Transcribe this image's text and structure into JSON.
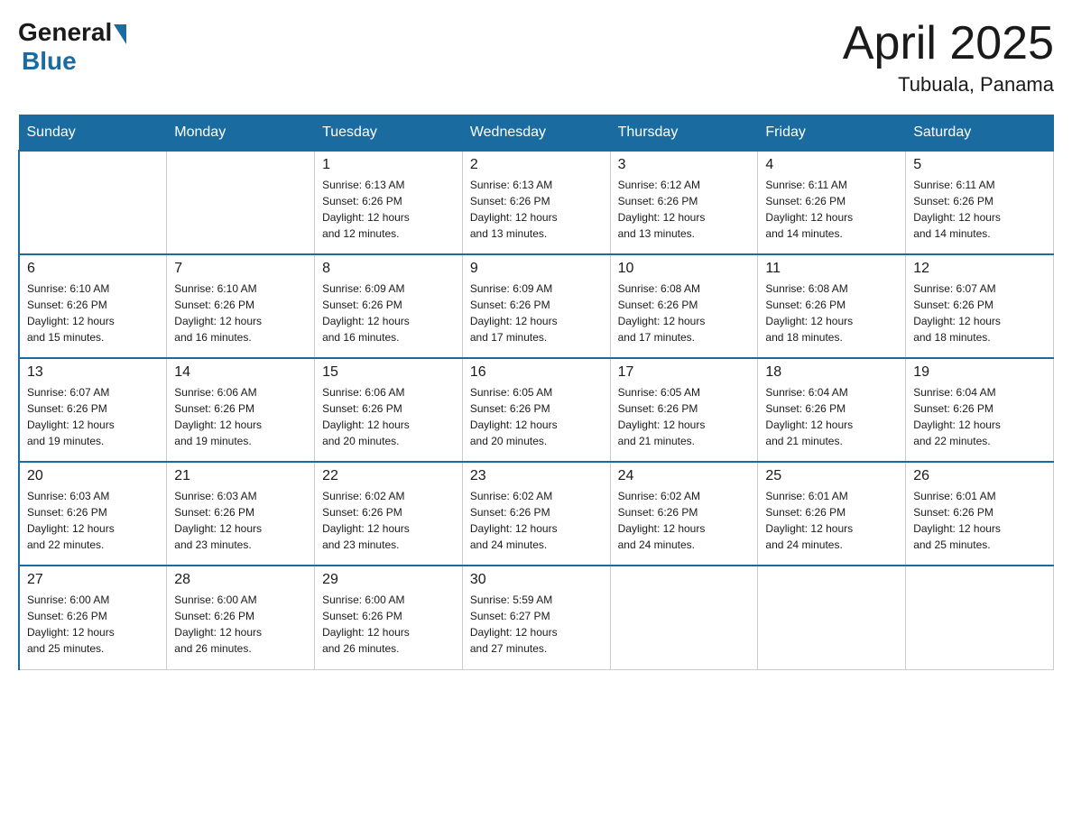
{
  "logo": {
    "general": "General",
    "blue": "Blue"
  },
  "title": "April 2025",
  "location": "Tubuala, Panama",
  "days_of_week": [
    "Sunday",
    "Monday",
    "Tuesday",
    "Wednesday",
    "Thursday",
    "Friday",
    "Saturday"
  ],
  "weeks": [
    [
      {
        "day": "",
        "info": ""
      },
      {
        "day": "",
        "info": ""
      },
      {
        "day": "1",
        "info": "Sunrise: 6:13 AM\nSunset: 6:26 PM\nDaylight: 12 hours\nand 12 minutes."
      },
      {
        "day": "2",
        "info": "Sunrise: 6:13 AM\nSunset: 6:26 PM\nDaylight: 12 hours\nand 13 minutes."
      },
      {
        "day": "3",
        "info": "Sunrise: 6:12 AM\nSunset: 6:26 PM\nDaylight: 12 hours\nand 13 minutes."
      },
      {
        "day": "4",
        "info": "Sunrise: 6:11 AM\nSunset: 6:26 PM\nDaylight: 12 hours\nand 14 minutes."
      },
      {
        "day": "5",
        "info": "Sunrise: 6:11 AM\nSunset: 6:26 PM\nDaylight: 12 hours\nand 14 minutes."
      }
    ],
    [
      {
        "day": "6",
        "info": "Sunrise: 6:10 AM\nSunset: 6:26 PM\nDaylight: 12 hours\nand 15 minutes."
      },
      {
        "day": "7",
        "info": "Sunrise: 6:10 AM\nSunset: 6:26 PM\nDaylight: 12 hours\nand 16 minutes."
      },
      {
        "day": "8",
        "info": "Sunrise: 6:09 AM\nSunset: 6:26 PM\nDaylight: 12 hours\nand 16 minutes."
      },
      {
        "day": "9",
        "info": "Sunrise: 6:09 AM\nSunset: 6:26 PM\nDaylight: 12 hours\nand 17 minutes."
      },
      {
        "day": "10",
        "info": "Sunrise: 6:08 AM\nSunset: 6:26 PM\nDaylight: 12 hours\nand 17 minutes."
      },
      {
        "day": "11",
        "info": "Sunrise: 6:08 AM\nSunset: 6:26 PM\nDaylight: 12 hours\nand 18 minutes."
      },
      {
        "day": "12",
        "info": "Sunrise: 6:07 AM\nSunset: 6:26 PM\nDaylight: 12 hours\nand 18 minutes."
      }
    ],
    [
      {
        "day": "13",
        "info": "Sunrise: 6:07 AM\nSunset: 6:26 PM\nDaylight: 12 hours\nand 19 minutes."
      },
      {
        "day": "14",
        "info": "Sunrise: 6:06 AM\nSunset: 6:26 PM\nDaylight: 12 hours\nand 19 minutes."
      },
      {
        "day": "15",
        "info": "Sunrise: 6:06 AM\nSunset: 6:26 PM\nDaylight: 12 hours\nand 20 minutes."
      },
      {
        "day": "16",
        "info": "Sunrise: 6:05 AM\nSunset: 6:26 PM\nDaylight: 12 hours\nand 20 minutes."
      },
      {
        "day": "17",
        "info": "Sunrise: 6:05 AM\nSunset: 6:26 PM\nDaylight: 12 hours\nand 21 minutes."
      },
      {
        "day": "18",
        "info": "Sunrise: 6:04 AM\nSunset: 6:26 PM\nDaylight: 12 hours\nand 21 minutes."
      },
      {
        "day": "19",
        "info": "Sunrise: 6:04 AM\nSunset: 6:26 PM\nDaylight: 12 hours\nand 22 minutes."
      }
    ],
    [
      {
        "day": "20",
        "info": "Sunrise: 6:03 AM\nSunset: 6:26 PM\nDaylight: 12 hours\nand 22 minutes."
      },
      {
        "day": "21",
        "info": "Sunrise: 6:03 AM\nSunset: 6:26 PM\nDaylight: 12 hours\nand 23 minutes."
      },
      {
        "day": "22",
        "info": "Sunrise: 6:02 AM\nSunset: 6:26 PM\nDaylight: 12 hours\nand 23 minutes."
      },
      {
        "day": "23",
        "info": "Sunrise: 6:02 AM\nSunset: 6:26 PM\nDaylight: 12 hours\nand 24 minutes."
      },
      {
        "day": "24",
        "info": "Sunrise: 6:02 AM\nSunset: 6:26 PM\nDaylight: 12 hours\nand 24 minutes."
      },
      {
        "day": "25",
        "info": "Sunrise: 6:01 AM\nSunset: 6:26 PM\nDaylight: 12 hours\nand 24 minutes."
      },
      {
        "day": "26",
        "info": "Sunrise: 6:01 AM\nSunset: 6:26 PM\nDaylight: 12 hours\nand 25 minutes."
      }
    ],
    [
      {
        "day": "27",
        "info": "Sunrise: 6:00 AM\nSunset: 6:26 PM\nDaylight: 12 hours\nand 25 minutes."
      },
      {
        "day": "28",
        "info": "Sunrise: 6:00 AM\nSunset: 6:26 PM\nDaylight: 12 hours\nand 26 minutes."
      },
      {
        "day": "29",
        "info": "Sunrise: 6:00 AM\nSunset: 6:26 PM\nDaylight: 12 hours\nand 26 minutes."
      },
      {
        "day": "30",
        "info": "Sunrise: 5:59 AM\nSunset: 6:27 PM\nDaylight: 12 hours\nand 27 minutes."
      },
      {
        "day": "",
        "info": ""
      },
      {
        "day": "",
        "info": ""
      },
      {
        "day": "",
        "info": ""
      }
    ]
  ]
}
